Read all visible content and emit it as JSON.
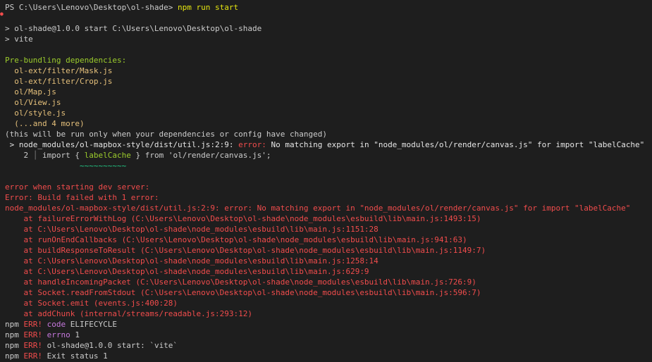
{
  "prompt": {
    "path": "PS C:\\Users\\Lenovo\\Desktop\\ol-shade> ",
    "command": "npm run start"
  },
  "script_start": [
    "> ol-shade@1.0.0 start C:\\Users\\Lenovo\\Desktop\\ol-shade",
    "> vite"
  ],
  "prebundle": {
    "heading": "Pre-bundling dependencies:",
    "items": [
      "  ol-ext/filter/Mask.js",
      "  ol-ext/filter/Crop.js",
      "  ol/Map.js",
      "  ol/View.js",
      "  ol/style.js",
      "  (...and 4 more)"
    ],
    "note": "(this will be run only when your dependencies or config have changed)"
  },
  "build_error": {
    "location": " > node_modules/ol-mapbox-style/dist/util.js:2:9: ",
    "label": "error: ",
    "message": "No matching export in \"node_modules/ol/render/canvas.js\" for import \"labelCache\"",
    "gutter_num": "    2 ",
    "pipe": "│",
    "code_pre": " import { ",
    "code_highlight": "labelCache",
    "code_post": " } from 'ol/render/canvas.js';",
    "squiggle": "                ~~~~~~~~~~"
  },
  "server_error": [
    "error when starting dev server:",
    "Error: Build failed with 1 error:",
    "node_modules/ol-mapbox-style/dist/util.js:2:9: error: No matching export in \"node_modules/ol/render/canvas.js\" for import \"labelCache\"",
    "    at failureErrorWithLog (C:\\Users\\Lenovo\\Desktop\\ol-shade\\node_modules\\esbuild\\lib\\main.js:1493:15)",
    "    at C:\\Users\\Lenovo\\Desktop\\ol-shade\\node_modules\\esbuild\\lib\\main.js:1151:28",
    "    at runOnEndCallbacks (C:\\Users\\Lenovo\\Desktop\\ol-shade\\node_modules\\esbuild\\lib\\main.js:941:63)",
    "    at buildResponseToResult (C:\\Users\\Lenovo\\Desktop\\ol-shade\\node_modules\\esbuild\\lib\\main.js:1149:7)",
    "    at C:\\Users\\Lenovo\\Desktop\\ol-shade\\node_modules\\esbuild\\lib\\main.js:1258:14",
    "    at C:\\Users\\Lenovo\\Desktop\\ol-shade\\node_modules\\esbuild\\lib\\main.js:629:9",
    "    at handleIncomingPacket (C:\\Users\\Lenovo\\Desktop\\ol-shade\\node_modules\\esbuild\\lib\\main.js:726:9)",
    "    at Socket.readFromStdout (C:\\Users\\Lenovo\\Desktop\\ol-shade\\node_modules\\esbuild\\lib\\main.js:596:7)",
    "    at Socket.emit (events.js:400:28)",
    "    at addChunk (internal/streams/readable.js:293:12)"
  ],
  "npm_err": {
    "prefix": "npm ",
    "err": "ERR!",
    "lines": [
      {
        "key": " code",
        "value": " ELIFECYCLE"
      },
      {
        "key": " errno",
        "value": " 1"
      },
      {
        "key": "",
        "value": " ol-shade@1.0.0 start: `vite`"
      },
      {
        "key": "",
        "value": " Exit status 1"
      }
    ]
  },
  "colors": {
    "background": "#1e1e1e",
    "text": "#cccccc",
    "command": "#e5e510",
    "success": "#9ccc2c",
    "error": "#f14c4c",
    "accent": "#c678dd"
  }
}
